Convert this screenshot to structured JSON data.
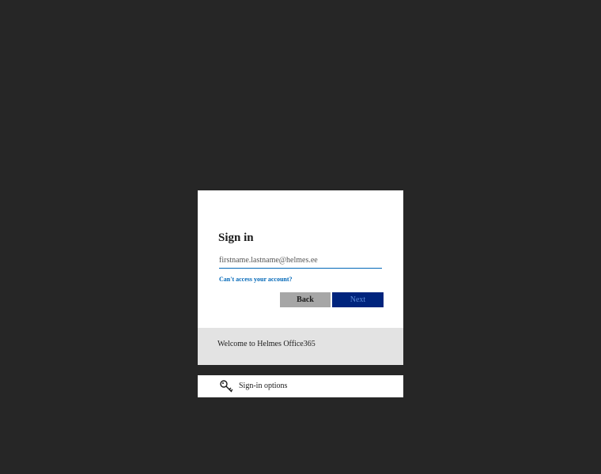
{
  "signin": {
    "title": "Sign in",
    "email_placeholder": "firstname.lastname@helmes.ee",
    "help_link": "Can't access your account?",
    "back_label": "Back",
    "next_label": "Next"
  },
  "banner": {
    "text": "Welcome to Helmes Office365"
  },
  "options": {
    "label": "Sign-in options",
    "icon": "key-icon"
  },
  "colors": {
    "background": "#262626",
    "accent": "#0067b8",
    "next_button": "#00247d",
    "back_button": "#a6a6a6",
    "banner": "#e3e3e3"
  }
}
